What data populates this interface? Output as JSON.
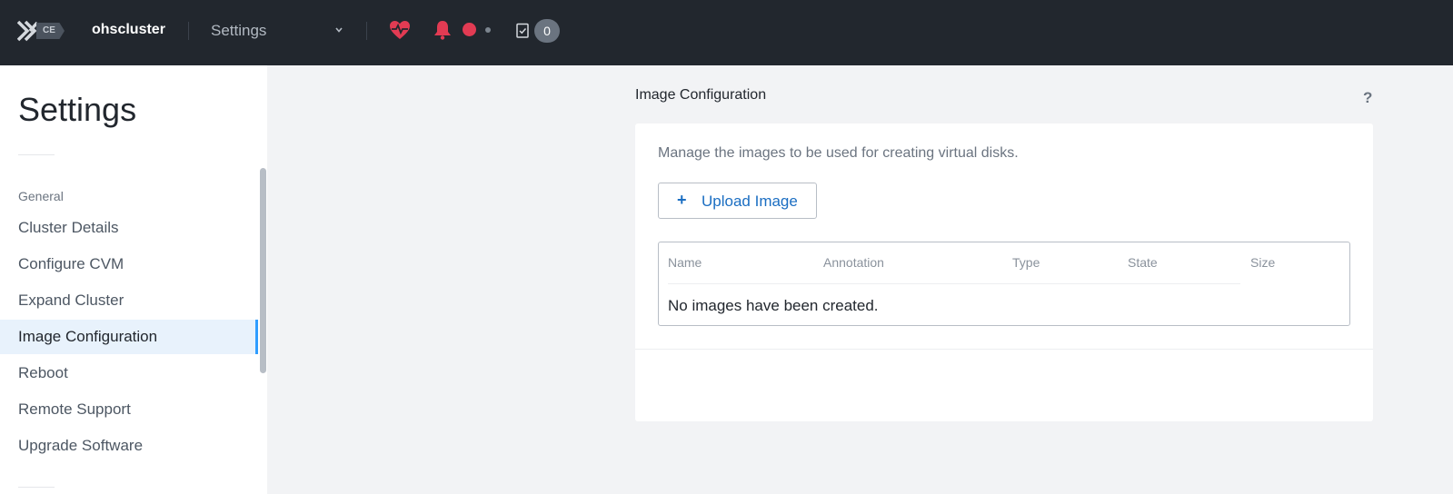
{
  "topbar": {
    "logo_badge": "CE",
    "cluster_name": "ohscluster",
    "nav_select": "Settings",
    "task_count": "0",
    "icons": [
      "nutanix-x-logo",
      "health-heart-icon",
      "alerts-bell-icon",
      "alert-dot",
      "tasks-checklist-icon"
    ]
  },
  "sidebar": {
    "title": "Settings",
    "group": "General",
    "items": [
      {
        "label": "Cluster Details"
      },
      {
        "label": "Configure CVM"
      },
      {
        "label": "Expand Cluster"
      },
      {
        "label": "Image Configuration",
        "active": true
      },
      {
        "label": "Reboot"
      },
      {
        "label": "Remote Support"
      },
      {
        "label": "Upgrade Software"
      }
    ]
  },
  "main": {
    "section_title": "Image Configuration",
    "help": "?",
    "description": "Manage the images to be used for creating virtual disks.",
    "upload_button": {
      "plus": "+",
      "label": "Upload Image"
    },
    "table": {
      "columns": [
        "Name",
        "Annotation",
        "Type",
        "State",
        "Size"
      ],
      "empty_message": "No images have been created."
    }
  },
  "colors": {
    "topbar_bg": "#22272e",
    "accent": "#2f9dff",
    "link": "#1b6ec2",
    "alert": "#e23b53",
    "active_item_bg": "#e8f2fc"
  }
}
